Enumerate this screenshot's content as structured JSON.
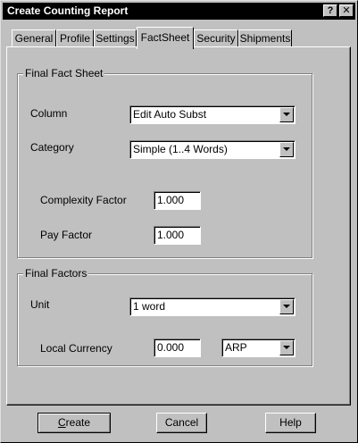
{
  "window": {
    "title": "Create Counting Report",
    "help_glyph": "?",
    "close_glyph": "✕"
  },
  "tabs": [
    {
      "label": "General",
      "active": false
    },
    {
      "label": "Profile",
      "active": false
    },
    {
      "label": "Settings",
      "active": false
    },
    {
      "label": "FactSheet",
      "active": true
    },
    {
      "label": "Security",
      "active": false
    },
    {
      "label": "Shipments",
      "active": false
    }
  ],
  "final_fact_sheet": {
    "title": "Final Fact Sheet",
    "column_label": "Column",
    "column_value": "Edit Auto Subst",
    "category_label": "Category",
    "category_value": "Simple  (1..4 Words)",
    "complexity_label": "Complexity Factor",
    "complexity_value": "1.000",
    "pay_label": "Pay Factor",
    "pay_value": "1.000"
  },
  "final_factors": {
    "title": "Final Factors",
    "unit_label": "Unit",
    "unit_value": "1 word",
    "currency_label": "Local Currency",
    "currency_value": "0.000",
    "currency_code": "ARP"
  },
  "buttons": {
    "create": "Create",
    "cancel": "Cancel",
    "help": "Help"
  },
  "icons": {
    "help": "question-mark-icon",
    "close": "close-x-icon",
    "dropdown": "chevron-down-icon"
  }
}
